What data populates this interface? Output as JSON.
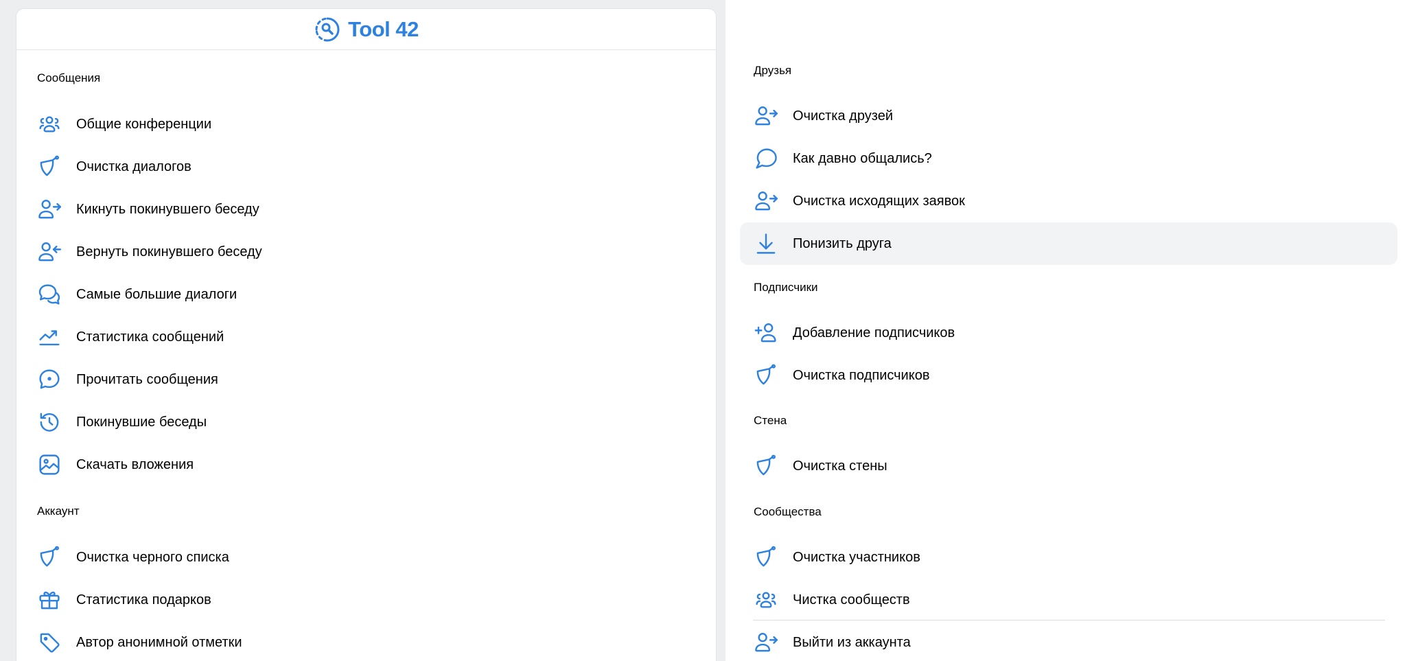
{
  "app": {
    "logo_text": "Tool 42",
    "accent_color": "#2d81e0"
  },
  "left": {
    "sections": [
      {
        "title": "Сообщения",
        "items": [
          {
            "label": "Общие конференции",
            "icon": "users-group-icon"
          },
          {
            "label": "Очистка диалогов",
            "icon": "broom-icon"
          },
          {
            "label": "Кикнуть покинувшего беседу",
            "icon": "user-arrow-right-icon"
          },
          {
            "label": "Вернуть покинувшего беседу",
            "icon": "user-arrow-left-icon"
          },
          {
            "label": "Самые большие диалоги",
            "icon": "chat-bubbles-icon"
          },
          {
            "label": "Статистика сообщений",
            "icon": "trend-chart-icon"
          },
          {
            "label": "Прочитать сообщения",
            "icon": "chat-dot-icon"
          },
          {
            "label": "Покинувшие беседы",
            "icon": "history-icon"
          },
          {
            "label": "Скачать вложения",
            "icon": "image-icon"
          }
        ]
      },
      {
        "title": "Аккаунт",
        "items": [
          {
            "label": "Очистка черного списка",
            "icon": "broom-icon"
          },
          {
            "label": "Статистика подарков",
            "icon": "gift-icon"
          },
          {
            "label": "Автор анонимной отметки",
            "icon": "tag-icon"
          }
        ]
      }
    ]
  },
  "right": {
    "sections": [
      {
        "title": "Друзья",
        "items": [
          {
            "label": "Очистка друзей",
            "icon": "user-arrow-right-icon"
          },
          {
            "label": "Как давно общались?",
            "icon": "chat-bubble-icon"
          },
          {
            "label": "Очистка исходящих заявок",
            "icon": "user-arrow-right-icon"
          },
          {
            "label": "Понизить друга",
            "icon": "arrow-down-icon",
            "highlighted": true
          }
        ]
      },
      {
        "title": "Подписчики",
        "items": [
          {
            "label": "Добавление подписчиков",
            "icon": "user-add-icon"
          },
          {
            "label": "Очистка подписчиков",
            "icon": "broom-icon"
          }
        ]
      },
      {
        "title": "Стена",
        "items": [
          {
            "label": "Очистка стены",
            "icon": "broom-icon"
          }
        ]
      },
      {
        "title": "Сообщества",
        "items": [
          {
            "label": "Очистка участников",
            "icon": "broom-icon"
          },
          {
            "label": "Чистка сообществ",
            "icon": "users-group-icon"
          }
        ]
      }
    ],
    "logout": {
      "label": "Выйти из аккаунта",
      "icon": "user-arrow-right-icon"
    }
  }
}
